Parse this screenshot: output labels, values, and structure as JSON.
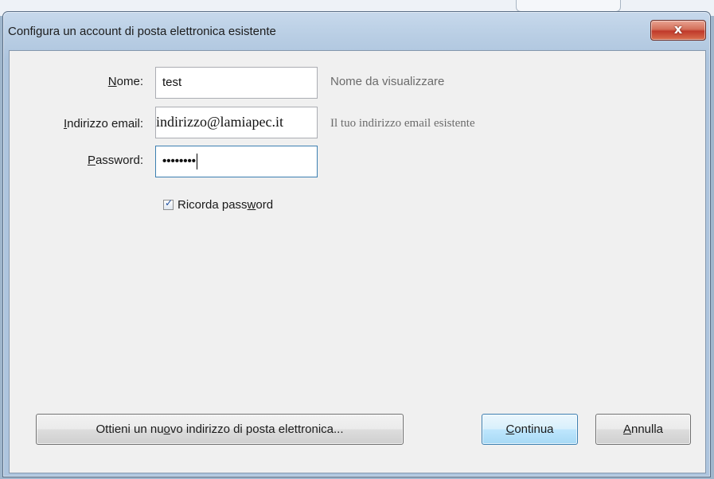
{
  "window": {
    "title": "Configura un account di posta elettronica esistente",
    "close_label": "x",
    "colors": {
      "titlebar": "#b9cee4",
      "close_button": "#c0392b",
      "client_bg": "#f0f0f0",
      "default_button": "#bee6fd",
      "focus_border": "#3c7fb1"
    }
  },
  "form": {
    "name": {
      "label_pre": "",
      "label_mnemonic": "N",
      "label_post": "ome:",
      "value": "test",
      "hint": "Nome da visualizzare"
    },
    "email": {
      "label_pre": "",
      "label_mnemonic": "I",
      "label_post": "ndirizzo email:",
      "value": "indirizzo@lamiapec.it",
      "hint": "Il tuo indirizzo email esistente"
    },
    "password": {
      "label_pre": "",
      "label_mnemonic": "P",
      "label_post": "assword:",
      "value": "••••••••",
      "masked": true
    },
    "remember": {
      "checked": true,
      "label_pre": "Ricorda pass",
      "label_mnemonic": "w",
      "label_post": "ord"
    }
  },
  "buttons": {
    "new_address": {
      "label_pre": "Ottieni un nu",
      "label_mnemonic": "o",
      "label_post": "vo indirizzo di posta elettronica..."
    },
    "continue": {
      "label_pre": "",
      "label_mnemonic": "C",
      "label_post": "ontinua"
    },
    "cancel": {
      "label_pre": "",
      "label_mnemonic": "A",
      "label_post": "nnulla"
    }
  }
}
